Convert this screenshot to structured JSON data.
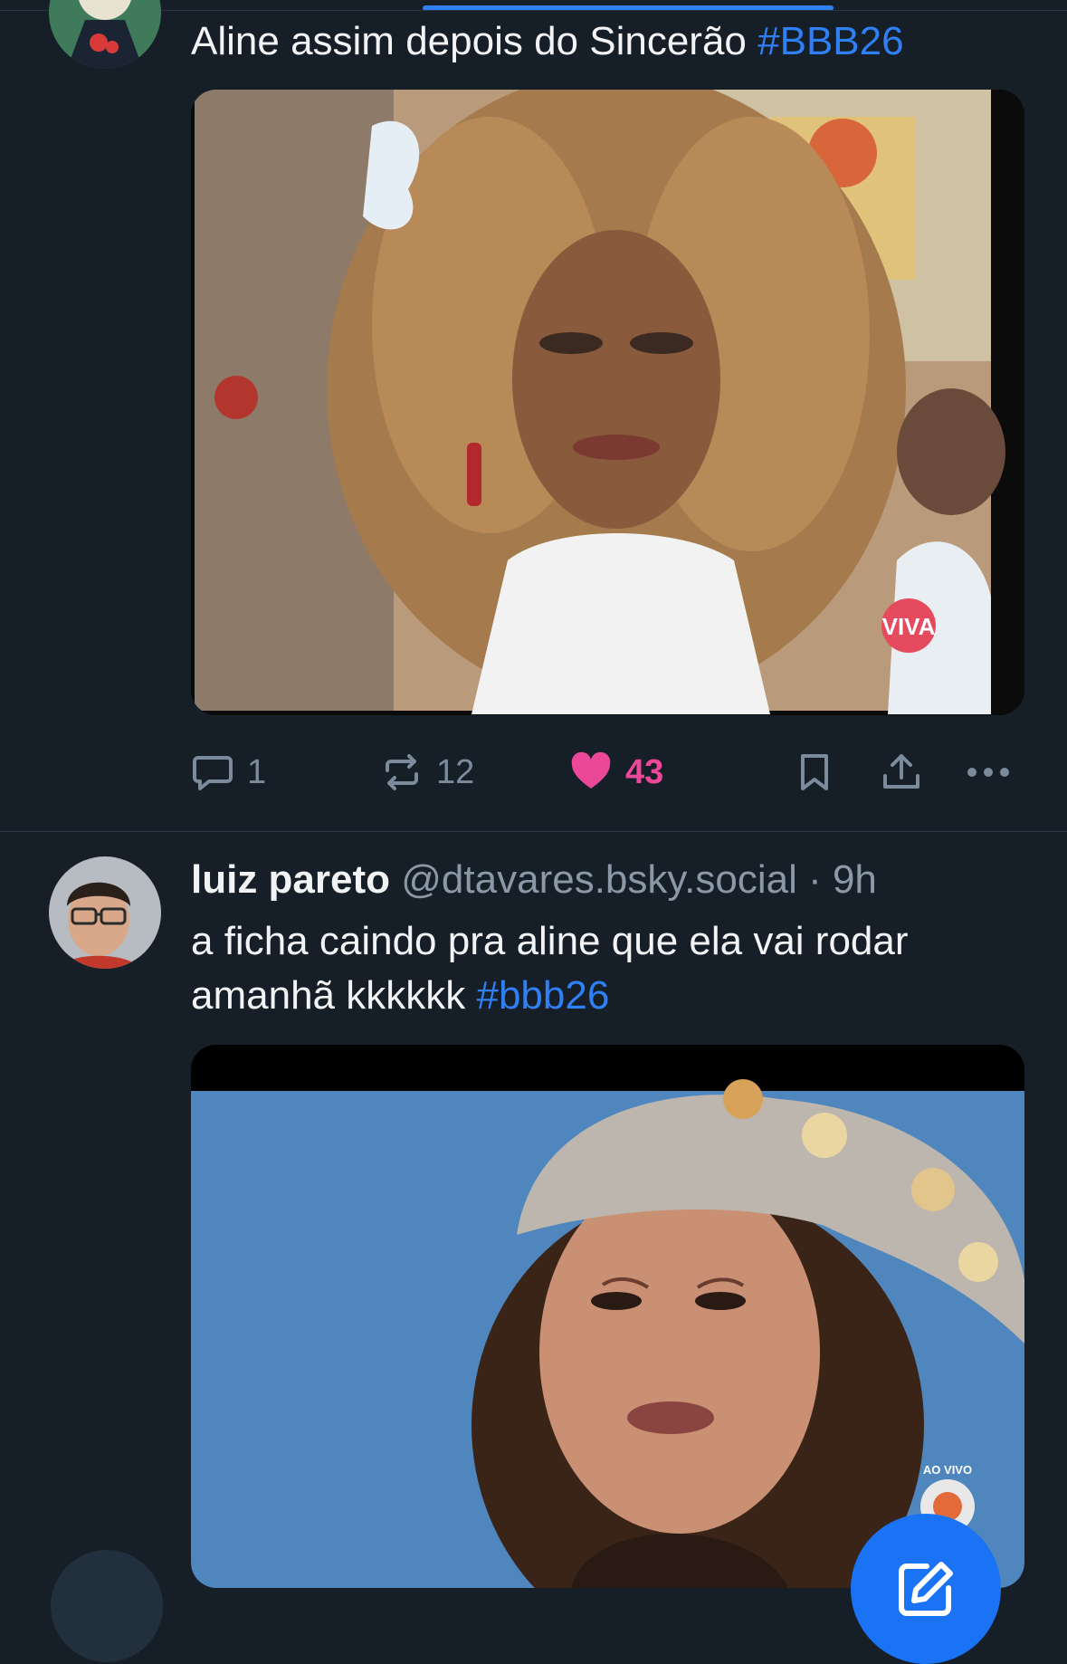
{
  "post1": {
    "text": "Aline assim depois do Sincerão ",
    "hashtag": "#BBB26",
    "media_badge": "VIVA",
    "actions": {
      "replies": "1",
      "reposts": "12",
      "likes": "43"
    }
  },
  "post2": {
    "author_name": "luiz pareto",
    "author_handle": "@dtavares.bsky.social",
    "separator": " · ",
    "time": "9h",
    "text": "a ficha caindo pra aline que ela vai rodar amanhã kkkkkk ",
    "hashtag": "#bbb26",
    "media_caption": "AO VIVO"
  },
  "colors": {
    "accent": "#2f7ff5",
    "like": "#ec4899",
    "background": "#161e27"
  },
  "icons": [
    "reply-icon",
    "repost-icon",
    "heart-icon",
    "bookmark-icon",
    "share-icon",
    "more-icon",
    "compose-icon"
  ]
}
